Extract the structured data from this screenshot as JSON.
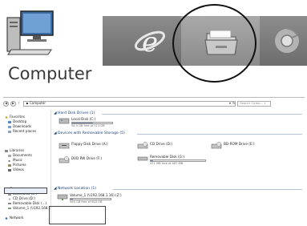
{
  "desktop": {
    "icon_label": "Computer"
  },
  "taskbar": {
    "buttons": [
      {
        "name": "Internet Explorer",
        "icon": "ie-icon"
      },
      {
        "name": "Windows Explorer",
        "icon": "folder-icon"
      },
      {
        "name": "Google Chrome",
        "icon": "chrome-icon"
      }
    ]
  },
  "explorer": {
    "toolbar": {
      "back": "◀",
      "forward": "▶",
      "up": "↑",
      "breadcrumb": "Computer",
      "dropdown": "▾",
      "refresh": "↻",
      "search_placeholder": "Search Comp... ⌕"
    },
    "sidebar": {
      "favorites": [
        "Favorites",
        "Desktop",
        "Downloads",
        "Recent places"
      ],
      "libraries": [
        "Libraries",
        "Documents",
        "Music",
        "Pictures",
        "Videos"
      ],
      "computer": [
        "Computer",
        "Local Disk (C:)",
        "CD Drive (D:)",
        "Removable Disk (...)",
        "Volume_1 (\\\\192.168..."
      ],
      "network": "Network"
    },
    "sections": {
      "hard_disks": "Hard Disk Drives (1)",
      "removable": "Devices with Removable Storage (5)",
      "network_loc": "Network Location (1)"
    },
    "drives": {
      "c": {
        "name": "Local Disk (C:)",
        "free": "54.5 GB free of 111 GB",
        "used_fraction": 0.51
      },
      "floppy": {
        "name": "Floppy Disk Drive (A:)"
      },
      "cd": {
        "name": "CD Drive (D:)"
      },
      "bd": {
        "name": "BD-ROM Drive (E:)"
      },
      "dvd": {
        "name": "DVD RW Drive (F:)"
      },
      "removable": {
        "name": "Removable Disk (G:)",
        "free": "471 MB free of 467 MB",
        "used_fraction": 0.05
      },
      "volume": {
        "name": "Volume_1 (\\\\192.168.1.16) (Z:)",
        "free": "565 GB free of 603 GB",
        "used_fraction": 0.06
      }
    }
  }
}
